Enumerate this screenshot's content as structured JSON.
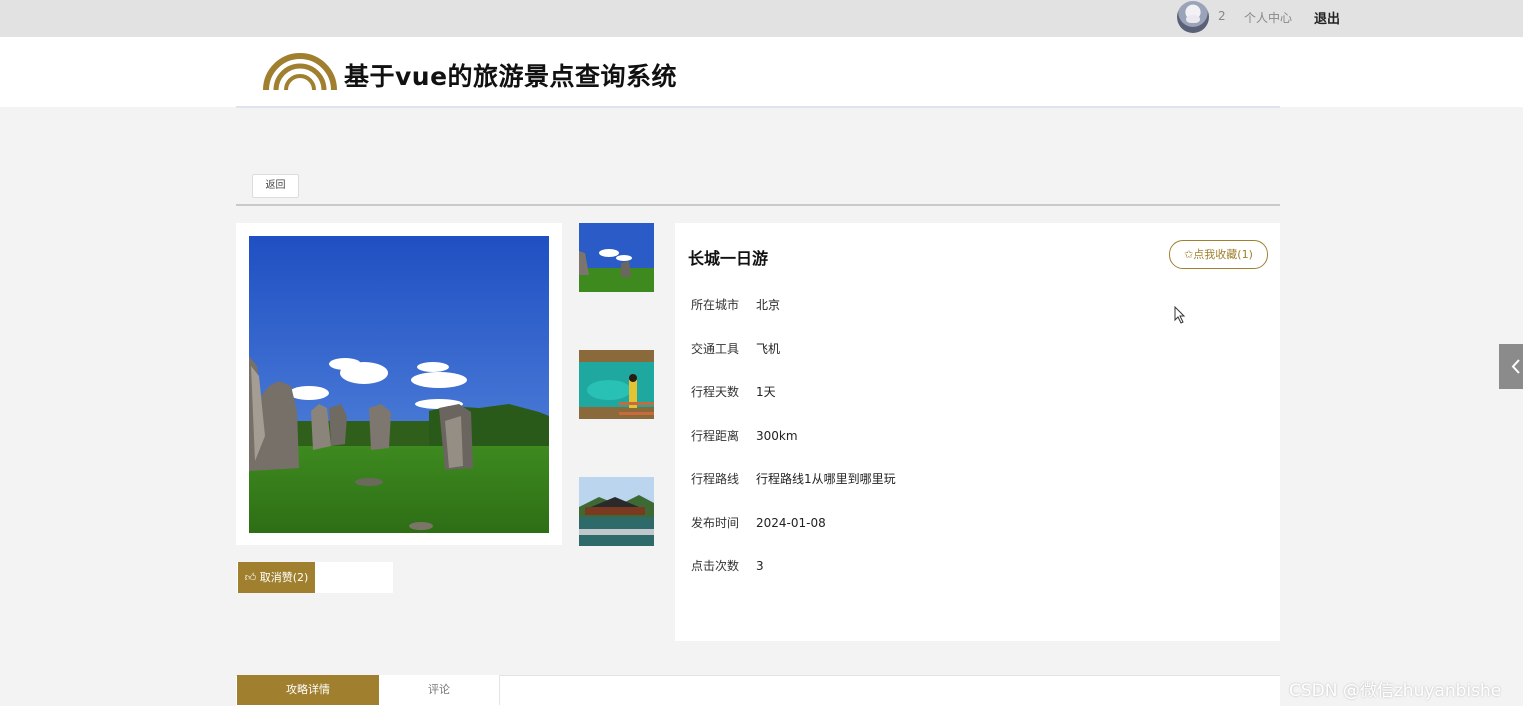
{
  "topbar": {
    "username": "2",
    "profile_link": "个人中心",
    "logout_label": "退出"
  },
  "header": {
    "site_title": "基于vue的旅游景点查询系统",
    "brand_color": "#a0802f"
  },
  "toolbar": {
    "back_label": "返回"
  },
  "gallery": {
    "main_image": "stone-forest-landscape",
    "thumbnails": [
      "stone-forest-thumb",
      "turquoise-lake-thumb",
      "pavilion-thumb"
    ]
  },
  "like": {
    "label": "取消赞(2)"
  },
  "detail": {
    "title": "长城一日游",
    "favorite_label": "✩点我收藏(1)",
    "fields": [
      {
        "label": "所在城市",
        "value": "北京"
      },
      {
        "label": "交通工具",
        "value": "飞机"
      },
      {
        "label": "行程天数",
        "value": "1天"
      },
      {
        "label": "行程距离",
        "value": "300km"
      },
      {
        "label": "行程路线",
        "value": "行程路线1从哪里到哪里玩"
      },
      {
        "label": "发布时间",
        "value": "2024-01-08"
      },
      {
        "label": "点击次数",
        "value": "3"
      }
    ]
  },
  "tabs": [
    {
      "label": "攻略详情",
      "active": true
    },
    {
      "label": "评论",
      "active": false
    }
  ],
  "watermark": "CSDN @微信zhuyanbishe"
}
